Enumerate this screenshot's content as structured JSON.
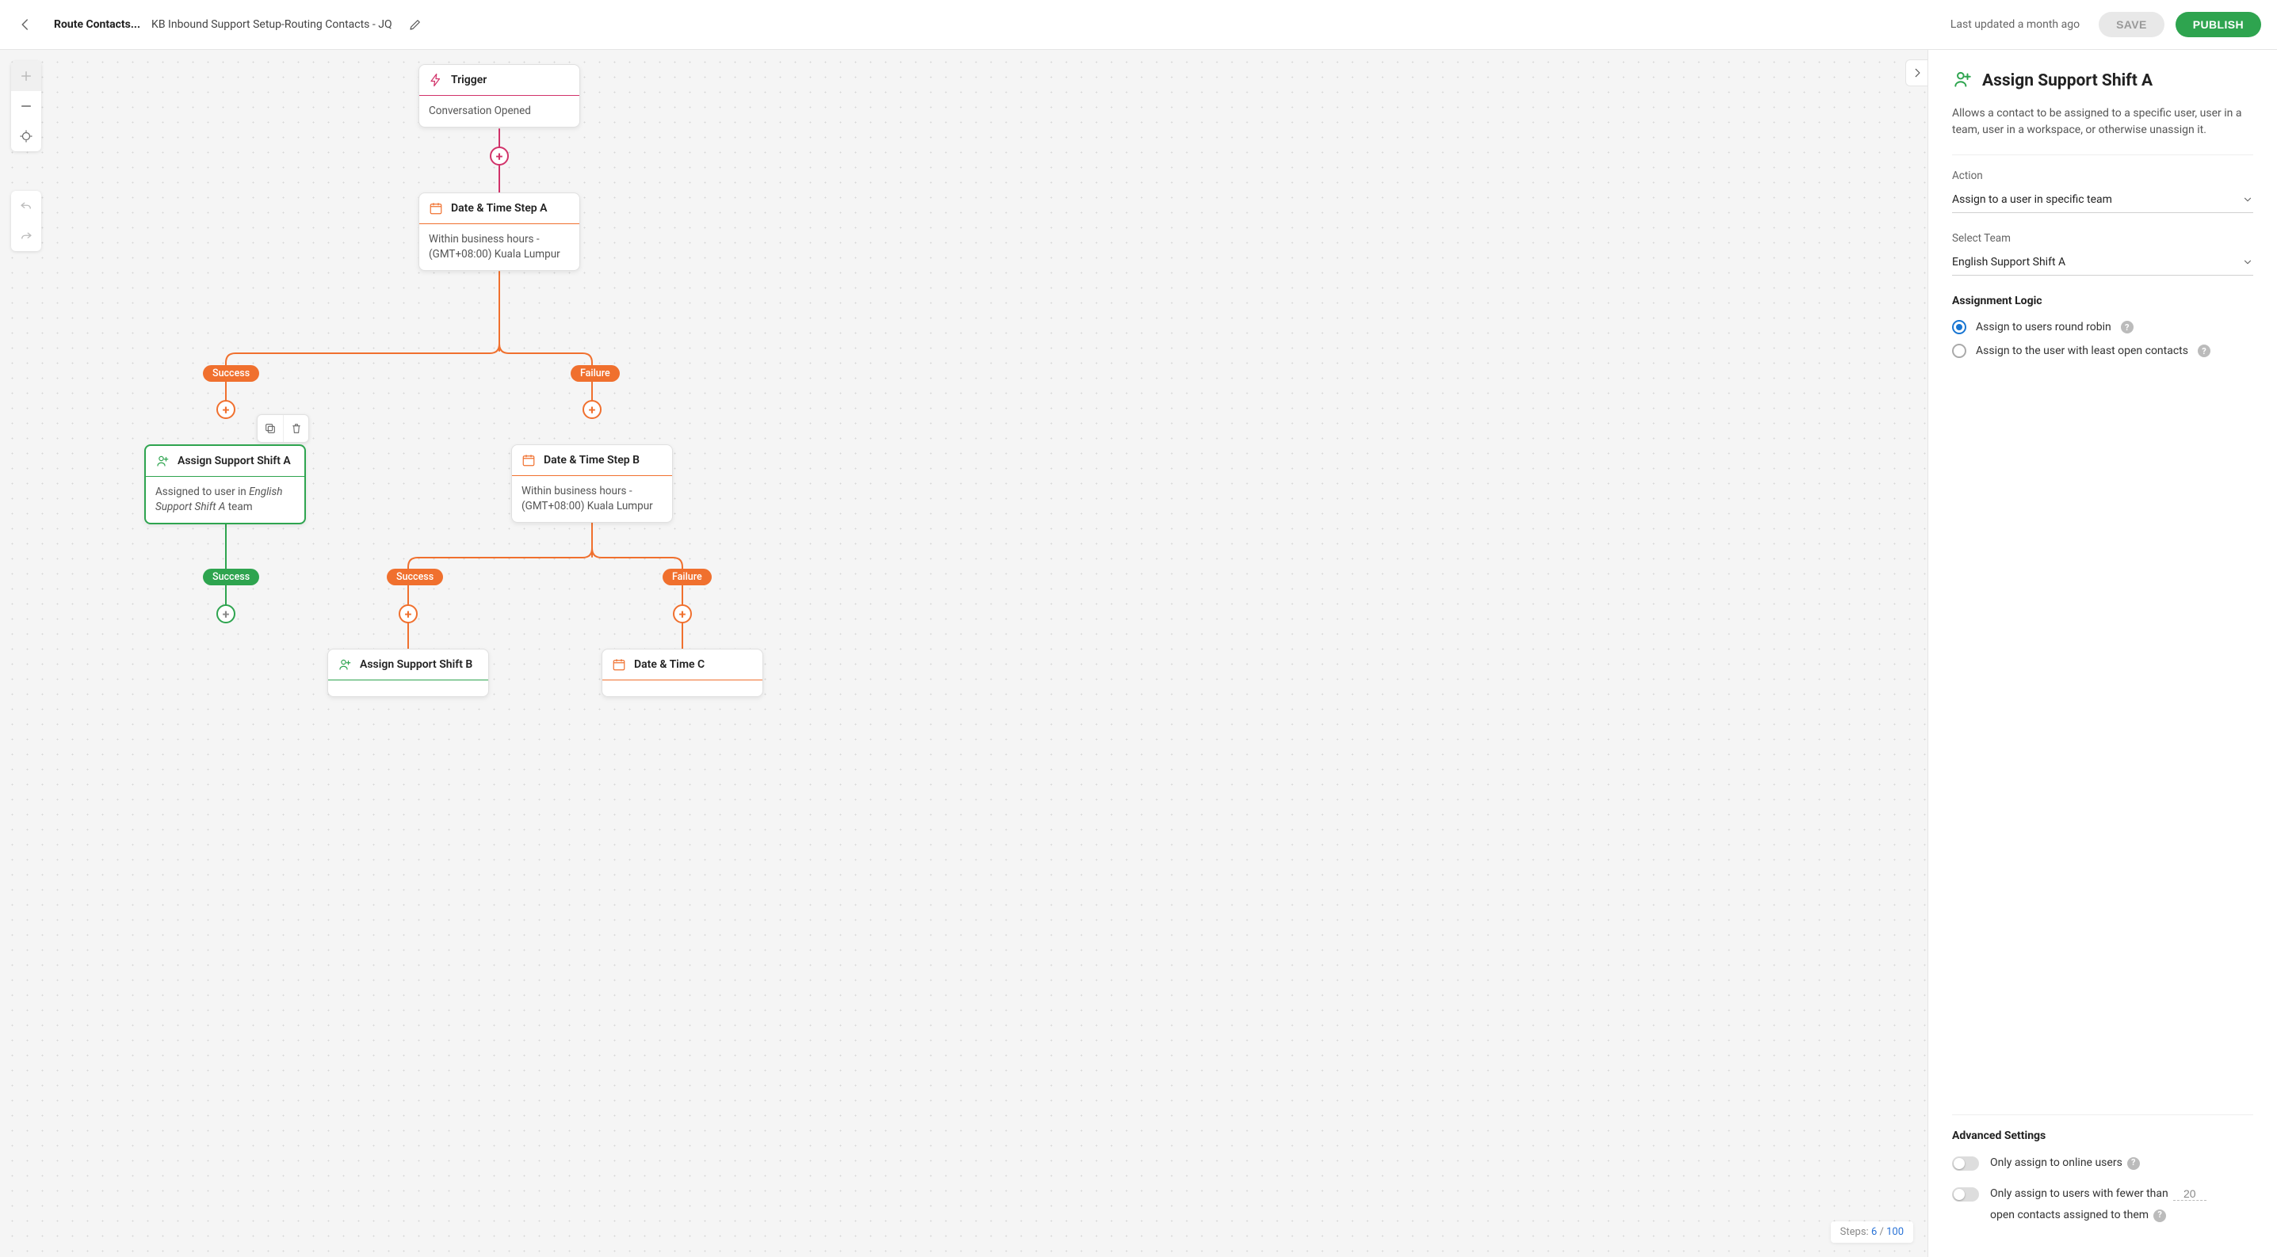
{
  "header": {
    "title": "Route Contacts...",
    "subtitle": "KB Inbound Support Setup-Routing Contacts - JQ",
    "updated": "Last updated a month ago",
    "save": "SAVE",
    "publish": "PUBLISH"
  },
  "nodes": {
    "trigger": {
      "title": "Trigger",
      "body": "Conversation Opened"
    },
    "dateA": {
      "title": "Date & Time Step A",
      "body": "Within business hours - (GMT+08:00) Kuala Lumpur"
    },
    "assignA": {
      "title": "Assign Support Shift A",
      "body_pre": "Assigned to user in ",
      "body_em": "English Support Shift A",
      "body_post": " team"
    },
    "dateB": {
      "title": "Date & Time Step B",
      "body": "Within business hours - (GMT+08:00) Kuala Lumpur"
    },
    "assignB": {
      "title": "Assign Support Shift B"
    },
    "dateC": {
      "title": "Date & Time C"
    }
  },
  "pills": {
    "success": "Success",
    "failure": "Failure"
  },
  "steps": {
    "label": "Steps:",
    "current": "6",
    "max": "100"
  },
  "sidebar": {
    "title": "Assign Support Shift A",
    "desc": "Allows a contact to be assigned to a specific user, user in a team, user in a workspace, or otherwise unassign it.",
    "action_label": "Action",
    "action_value": "Assign to a user in specific team",
    "team_label": "Select Team",
    "team_value": "English Support Shift A",
    "logic_label": "Assignment Logic",
    "opt_round_robin": "Assign to users round robin",
    "opt_least_open": "Assign to the user with least open contacts",
    "advanced_label": "Advanced Settings",
    "toggle_online": "Only assign to online users",
    "toggle_fewer_pre": "Only assign to users with fewer than",
    "toggle_fewer_num": "20",
    "toggle_fewer_post": "open contacts assigned to them"
  }
}
